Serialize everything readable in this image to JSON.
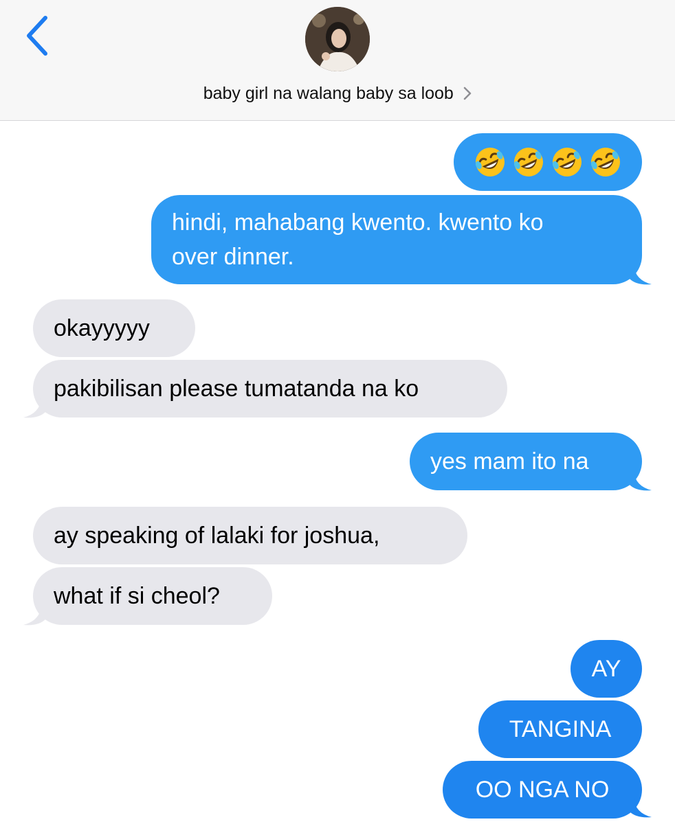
{
  "header": {
    "contact_name": "baby girl na walang baby sa loob"
  },
  "messages": [
    {
      "dir": "sent",
      "emoji": [
        "rofl",
        "rofl",
        "rofl",
        "rofl"
      ]
    },
    {
      "dir": "sent",
      "lines": [
        "hindi, mahabang kwento. kwento ko",
        "over dinner."
      ]
    },
    {
      "dir": "received",
      "text": "okayyyyy"
    },
    {
      "dir": "received",
      "text": "pakibilisan please tumatanda na ko"
    },
    {
      "dir": "sent",
      "text": "yes mam ito na"
    },
    {
      "dir": "received",
      "text": "ay speaking of lalaki for joshua,"
    },
    {
      "dir": "received",
      "text": "what if si cheol?"
    },
    {
      "dir": "sent",
      "text": "AY"
    },
    {
      "dir": "sent",
      "text": "TANGINA"
    },
    {
      "dir": "sent",
      "text": "OO NGA NO"
    }
  ],
  "colors": {
    "sent_bubble": "#2f9bf3",
    "sent_bubble_dark": "#1f85ef",
    "received_bubble": "#e7e7ec",
    "back_chevron": "#1e7cf0",
    "header_bg": "#f7f7f7"
  },
  "icons": {
    "back": "chevron-left-icon",
    "contact_details": "chevron-right-icon",
    "emoji": "rolling-on-floor-laughing-emoji"
  }
}
